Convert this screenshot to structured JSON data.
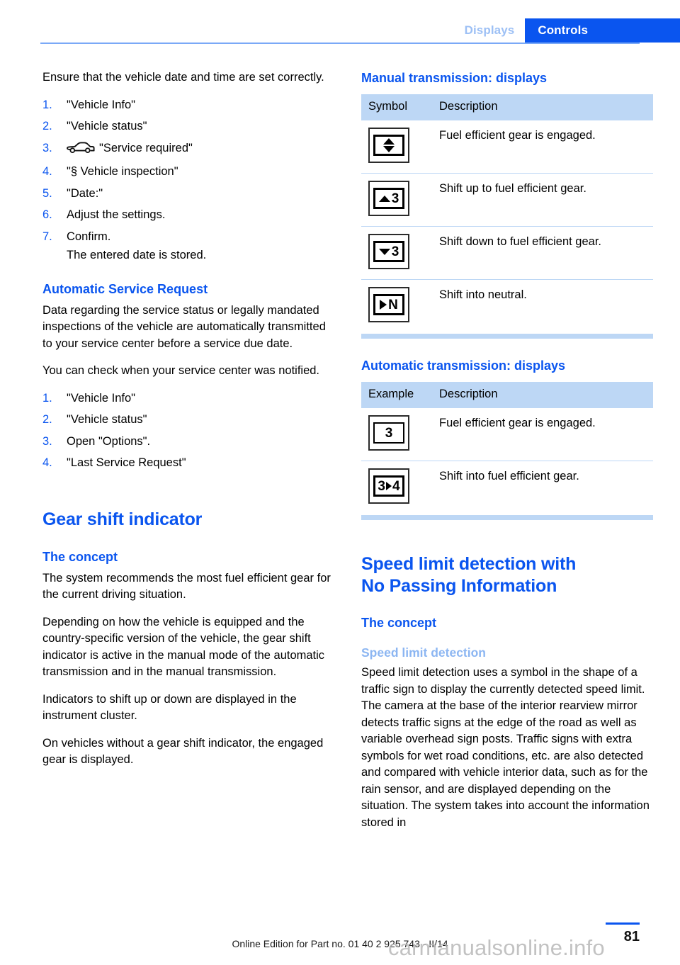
{
  "header": {
    "tab_inactive": "Displays",
    "tab_active": "Controls",
    "accent_color": "#0a55ef",
    "tab_inactive_color": "#9dc0f5"
  },
  "left_column": {
    "intro_paragraph": "Ensure that the vehicle date and time are set correctly.",
    "date_steps": [
      {
        "num": "1.",
        "text": "\"Vehicle Info\""
      },
      {
        "num": "2.",
        "text": "\"Vehicle status\""
      },
      {
        "num": "3.",
        "text": "\"Service required\"",
        "icon": "car-icon"
      },
      {
        "num": "4.",
        "text": "\"§ Vehicle inspection\""
      },
      {
        "num": "5.",
        "text": "\"Date:\""
      },
      {
        "num": "6.",
        "text": "Adjust the settings."
      },
      {
        "num": "7.",
        "text": "Confirm."
      }
    ],
    "date_steps_note": "The entered date is stored.",
    "service_request": {
      "heading": "Automatic Service Request",
      "paragraph_1": "Data regarding the service status or legally mandated inspections of the vehicle are automatically transmitted to your service center before a service due date.",
      "paragraph_2": "You can check when your service center was notified.",
      "steps": [
        {
          "num": "1.",
          "text": "\"Vehicle Info\""
        },
        {
          "num": "2.",
          "text": "\"Vehicle status\""
        },
        {
          "num": "3.",
          "text": "Open \"Options\"."
        },
        {
          "num": "4.",
          "text": "\"Last Service Request\""
        }
      ]
    },
    "gear_shift": {
      "chapter_heading": "Gear shift indicator",
      "section_heading": "The concept",
      "paragraph_1": "The system recommends the most fuel efficient gear for the current driving situation.",
      "paragraph_2": "Depending on how the vehicle is equipped and the country-specific version of the vehicle, the gear shift indicator is active in the manual mode of the automatic transmission and in the manual transmission.",
      "paragraph_3": "Indicators to shift up or down are displayed in the instrument cluster.",
      "paragraph_4": "On vehicles without a gear shift indicator, the engaged gear is displayed."
    }
  },
  "right_column": {
    "manual_table": {
      "heading": "Manual transmission: displays",
      "columns": [
        "Symbol",
        "Description"
      ],
      "rows": [
        {
          "symbol": "up-down-arrows-cluster-icon",
          "description": "Fuel efficient gear is engaged."
        },
        {
          "symbol": "arrow-up-3-cluster-icon",
          "symbol_text": "3",
          "description": "Shift up to fuel efficient gear."
        },
        {
          "symbol": "arrow-down-3-cluster-icon",
          "symbol_text": "3",
          "description": "Shift down to fuel efficient gear."
        },
        {
          "symbol": "arrow-right-n-cluster-icon",
          "symbol_text": "N",
          "description": "Shift into neutral."
        }
      ]
    },
    "automatic_table": {
      "heading": "Automatic transmission: displays",
      "columns": [
        "Example",
        "Description"
      ],
      "rows": [
        {
          "symbol": "gear-3-cluster-icon",
          "symbol_text": "3",
          "description": "Fuel efficient gear is engaged."
        },
        {
          "symbol": "gear-3-to-4-cluster-icon",
          "symbol_text_a": "3",
          "symbol_text_b": "4",
          "description": "Shift into fuel efficient gear."
        }
      ]
    },
    "speed_limit": {
      "chapter_heading_line_1": "Speed limit detection with",
      "chapter_heading_line_2": "No Passing Information",
      "section_heading": "The concept",
      "subsection_heading": "Speed limit detection",
      "paragraph_1": "Speed limit detection uses a symbol in the shape of a traffic sign to display the currently detected speed limit. The camera at the base of the interior rearview mirror detects traffic signs at the edge of the road as well as variable overhead sign posts. Traffic signs with extra symbols for wet road conditions, etc. are also detected and compared with vehicle interior data, such as for the rain sensor, and are displayed depending on the situation. The system takes into account the information stored in"
    }
  },
  "footer": {
    "edition_text": "Online Edition for Part no. 01 40 2 925 743 - II/14",
    "page_number": "81",
    "watermark": "carmanualsonline.info"
  }
}
